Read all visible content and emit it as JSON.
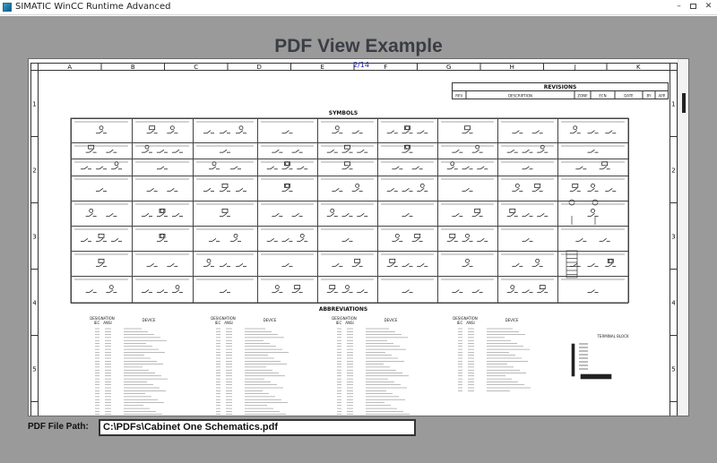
{
  "window": {
    "title": "SIMATIC WinCC Runtime Advanced",
    "controls": {
      "minimize": "–",
      "maximize": "",
      "close": "✕"
    }
  },
  "heading": "PDF View Example",
  "viewer": {
    "page_indicator": "2/14",
    "columns": [
      "A",
      "B",
      "C",
      "D",
      "E",
      "F",
      "G",
      "H",
      "J",
      "K"
    ],
    "rows": [
      "1",
      "2",
      "3",
      "4",
      "5"
    ],
    "revisions": {
      "title": "REVISIONS",
      "headers": [
        "REV",
        "DESCRIPTION",
        "ZONE",
        "ECN",
        "DATE",
        "BY",
        "APP"
      ]
    },
    "symbols_title": "SYMBOLS",
    "abbreviations_title": "ABBREVIATIONS",
    "abbrev_col_headers": {
      "designation": "DESIGNATION",
      "iec": "IEC",
      "ansi": "ANSI",
      "device": "DEVICE"
    },
    "terminal_block_label": "TERMINAL BLOCK"
  },
  "file_path": {
    "label": "PDF File Path:",
    "value": "C:\\PDFs\\Cabinet One Schematics.pdf"
  }
}
